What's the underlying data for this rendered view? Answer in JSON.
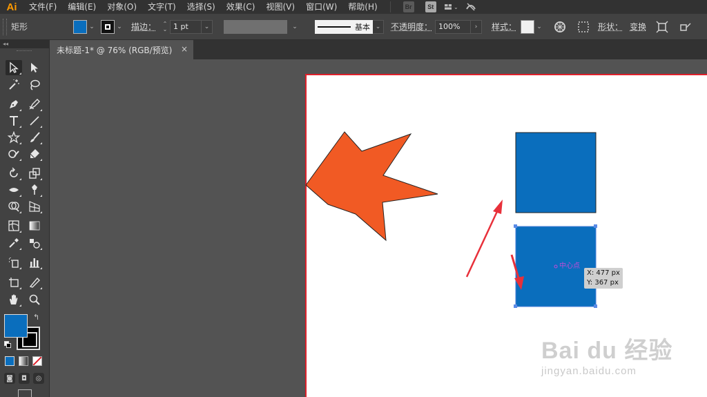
{
  "app": {
    "logo": "Ai"
  },
  "menu": {
    "items": [
      "文件(F)",
      "编辑(E)",
      "对象(O)",
      "文字(T)",
      "选择(S)",
      "效果(C)",
      "视图(V)",
      "窗口(W)",
      "帮助(H)"
    ],
    "bridge": "Br",
    "stock": "St"
  },
  "control": {
    "tool_name": "矩形",
    "stroke_label": "描边：",
    "stroke_weight": "1 pt",
    "stroke_style": "基本",
    "opacity_label": "不透明度：",
    "opacity_value": "100%",
    "style_label": "样式：",
    "shape_label": "形状：",
    "transform_label": "变换"
  },
  "document": {
    "tab_title": "未标题-1* @ 76% (RGB/预览)",
    "close": "×"
  },
  "artwork": {
    "fill_color": "#0a6ebd",
    "star_color": "#f15a24",
    "arrow_color": "#e8303a",
    "center_label": "中心点",
    "tooltip_x": "X: 477 px",
    "tooltip_y": "Y: 367 px"
  },
  "watermark": {
    "brand": "Bai du 经验",
    "url": "jingyan.baidu.com"
  },
  "colors": {
    "fill_swatch": "#0a6ebd",
    "stroke_swatch": "#000000"
  }
}
